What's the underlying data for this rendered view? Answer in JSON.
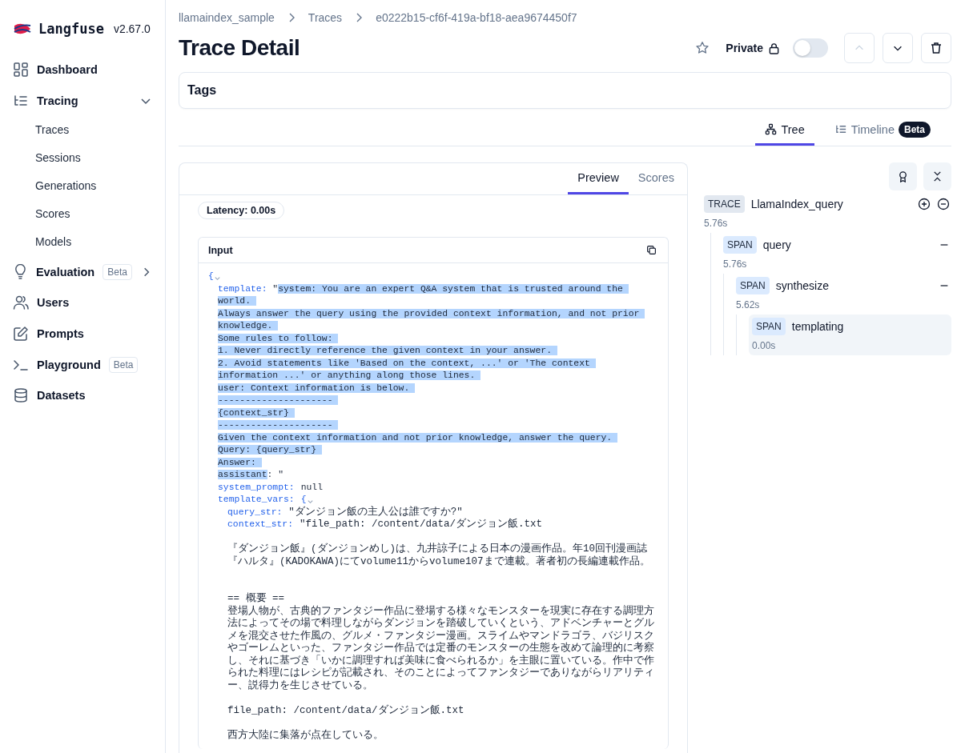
{
  "app": {
    "name": "Langfuse",
    "version": "v2.67.0"
  },
  "sidebar": {
    "items": [
      {
        "label": "Dashboard",
        "selected": false
      },
      {
        "label": "Tracing",
        "selected": false,
        "expanded": true,
        "children": [
          {
            "label": "Traces",
            "selected": false
          },
          {
            "label": "Sessions",
            "selected": false
          },
          {
            "label": "Generations",
            "selected": false
          },
          {
            "label": "Scores",
            "selected": false
          },
          {
            "label": "Models",
            "selected": false
          }
        ]
      },
      {
        "label": "Evaluation",
        "selected": false,
        "badge": "Beta",
        "expanded": false
      },
      {
        "label": "Users",
        "selected": false
      },
      {
        "label": "Prompts",
        "selected": false
      },
      {
        "label": "Playground",
        "selected": false,
        "badge": "Beta"
      },
      {
        "label": "Datasets",
        "selected": false
      }
    ]
  },
  "breadcrumbs": [
    "llamaindex_sample",
    "Traces",
    "e0222b15-cf6f-419a-bf18-aea9674450f7"
  ],
  "title": "Trace Detail",
  "header": {
    "visibility_label": "Private",
    "public": false,
    "previous_disabled": true,
    "next_disabled": false
  },
  "tags": {
    "label": "Tags"
  },
  "view_tabs": [
    {
      "label": "Tree",
      "selected": true
    },
    {
      "label": "Timeline",
      "selected": false,
      "badge": "Beta"
    }
  ],
  "detail_tabs": [
    {
      "label": "Preview",
      "selected": true
    },
    {
      "label": "Scores",
      "selected": false
    }
  ],
  "latency": "Latency: 0.00s",
  "input": {
    "label": "Input",
    "open": "{",
    "fields": [
      {
        "key": "template:",
        "segments": [
          {
            "text": " \"",
            "highlighted": false
          },
          {
            "text": "system: You are an expert Q&A system that is trusted around the ",
            "highlighted": true
          }
        ],
        "continuation": [
          {
            "text": "world. \nAlways answer the query using the provided context information, and not prior \nknowledge. \nSome rules to follow: \n1. Never directly reference the given context in your answer. \n2. Avoid statements like 'Based on the context, ...' or 'The context \ninformation ...' or anything along those lines. \nuser: Context information is below. \n--------------------- \n{context_str} \n--------------------- \nGiven the context information and not prior knowledge, answer the query. \nQuery: {query_str} \nAnswer: \nassistant",
            "highlighted": true
          },
          {
            "text": ": \"",
            "highlighted": false
          }
        ]
      },
      {
        "key": "system_prompt:",
        "value": "null"
      },
      {
        "key": "template_vars:",
        "open": "{",
        "children": [
          {
            "key": "query_str:",
            "value": "\"ダンジョン飯の主人公は誰ですか?\""
          },
          {
            "key": "context_str:",
            "value": "\"file_path: /content/data/ダンジョン飯.txt",
            "continuation": "『ダンジョン飯』(ダンジョンめし)は、九井諒子による日本の漫画作品。年10回刊漫画誌『ハルタ』(KADOKAWA)にてvolume11からvolume107まで連載。著者初の長編連載作品。\n\n\n== 概要 ==\n登場人物が、古典的ファンタジー作品に登場する様々なモンスターを現実に存在する調理方法によってその場で料理しながらダンジョンを踏破していくという、アドベンチャーとグルメを混交させた作風の、グルメ・ファンタジー漫画。スライムやマンドラゴラ、バジリスクやゴーレムといった、ファンタジー作品では定番のモンスターの生態を改めて論理的に考察し、それに基づき「いかに調理すれば美味に食べられるか」を主眼に置いている。作中で作られた料理にはレシピが記載され、そのことによってファンタジーでありながらリアリティー、説得力を生じさせている。\n\nfile_path: /content/data/ダンジョン飯.txt\n\n西方大陸に集落が点在している。"
          }
        ]
      }
    ]
  },
  "tree": {
    "type": "TRACE",
    "name": "LlamaIndex_query",
    "duration": "5.76s",
    "selected": false,
    "children": [
      {
        "type": "SPAN",
        "name": "query",
        "duration": "5.76s",
        "selected": false,
        "children": [
          {
            "type": "SPAN",
            "name": "synthesize",
            "duration": "5.62s",
            "selected": false,
            "children": [
              {
                "type": "SPAN",
                "name": "templating",
                "duration": "0.00s",
                "selected": true
              }
            ]
          }
        ]
      }
    ]
  }
}
